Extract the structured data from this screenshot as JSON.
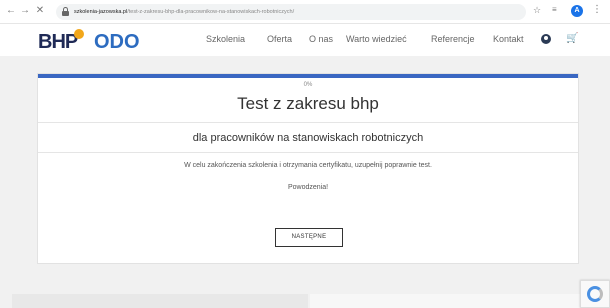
{
  "browser": {
    "url_host": "szkolenia-jazowska.pl",
    "url_path": "/test-z-zakresu-bhp-dla-pracownikow-na-stanowiskach-robotniczych/",
    "profile_initial": "A"
  },
  "header": {
    "logo_left": "BHP",
    "logo_right": "ODO",
    "nav": [
      "Szkolenia",
      "Oferta",
      "O nas",
      "Warto wiedzieć",
      "Referencje",
      "Kontakt"
    ]
  },
  "test": {
    "progress_label": "0%",
    "progress": 0,
    "title": "Test z zakresu bhp",
    "subtitle": "dla pracowników na stanowiskach robotniczych",
    "instruction": "W celu zakończenia szkolenia i otrzymania certyfikatu, uzupełnij poprawnie test.",
    "good_luck": "Powodzenia!",
    "next_label": "NASTĘPNE"
  },
  "colors": {
    "accent": "#3a67c2",
    "cart": "#e8891d",
    "logo_dark": "#1f2a56"
  }
}
